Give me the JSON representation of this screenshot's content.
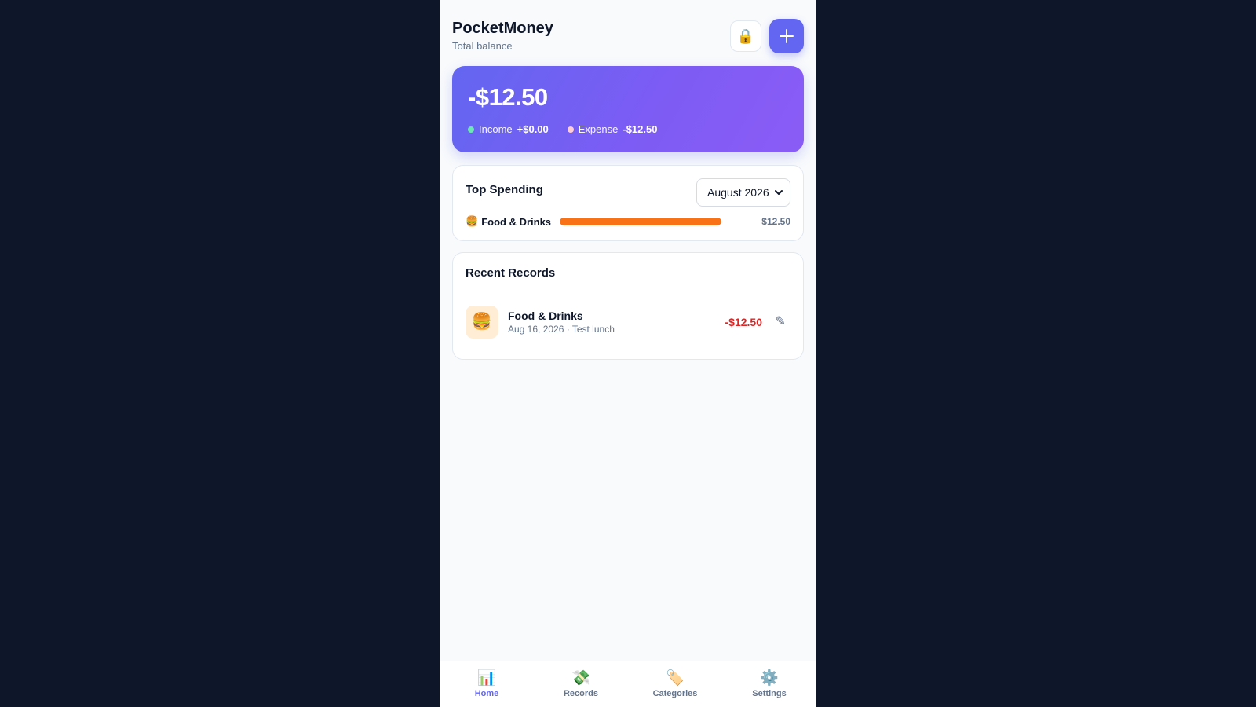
{
  "header": {
    "title": "PocketMoney",
    "subtitle": "Total balance",
    "lock_icon": "🔒",
    "add_icon": "plus-icon"
  },
  "balance": {
    "amount": "-$12.50",
    "income_label": "Income",
    "income_value": "+$0.00",
    "income_color": "#6ee7b7",
    "expense_label": "Expense",
    "expense_value": "-$12.50",
    "expense_color": "#fecdd3"
  },
  "top_spending": {
    "title": "Top Spending",
    "month": "August 2026",
    "items": [
      {
        "icon": "🍔",
        "label": "Food & Drinks",
        "value": "$12.50",
        "fraction": 1.0,
        "color": "#f97316"
      }
    ]
  },
  "recent_records": {
    "title": "Recent Records",
    "items": [
      {
        "icon": "🍔",
        "category": "Food & Drinks",
        "meta": "Aug 16, 2026 · Test lunch",
        "amount": "-$12.50",
        "edit_icon": "✎"
      }
    ]
  },
  "nav": {
    "items": [
      {
        "icon": "📊",
        "label": "Home",
        "active": true
      },
      {
        "icon": "💸",
        "label": "Records",
        "active": false
      },
      {
        "icon": "🏷️",
        "label": "Categories",
        "active": false
      },
      {
        "icon": "⚙️",
        "label": "Settings",
        "active": false
      }
    ]
  },
  "colors": {
    "accent": "#6366f1",
    "expense_red": "#dc2626",
    "bar_orange": "#f97316"
  }
}
